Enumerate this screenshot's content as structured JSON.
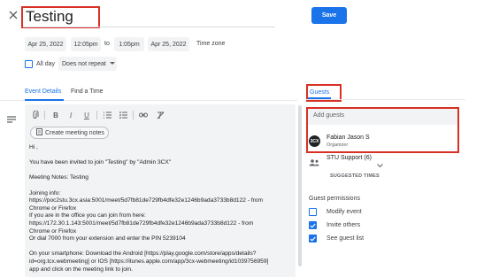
{
  "event": {
    "title": "Testing",
    "save_label": "Save"
  },
  "datetime": {
    "start_date": "Apr 25, 2022",
    "start_time": "12:05pm",
    "to": "to",
    "end_time": "1:05pm",
    "end_date": "Apr 25, 2022",
    "timezone_label": "Time zone",
    "all_day_label": "All day",
    "repeat_value": "Does not repeat"
  },
  "tabs": {
    "event_details": "Event Details",
    "find_a_time": "Find a Time"
  },
  "editor": {
    "meet_button": "Create meeting notes",
    "body": "Hi ,\n\nYou have been invited to join \"Testing\" by \"Admin 3CX\"\n\nMeeting Notes: Testing\n\nJoining info:\nhttps://poc2stu.3cx.asia:5001/meet/5d7fb81de729fb4dfe32e1246b9ada3733b8d122 - from\nChrome or Firefox\nIf you are in the office you can join from here:\nhttps://172.30.1.143:5001/meet/5d7fb81de729fb4dfe32e1246b9ada3733b8d122 - from\nChrome or Firefox\nOr dial 7000 from your extension and enter the PIN 5239104\n\nOn your smartphone: Download the Android [https://play.google.com/store/apps/details?\nid=org.tcx.webmeeting] or IOS [https://itunes.apple.com/app/3cx-webmeeting/id1039756959]\napp and click on the meeting link to join."
  },
  "guests": {
    "tab_label": "Guests",
    "add_placeholder": "Add guests",
    "organizer_name": "Fabian Jason S",
    "organizer_role": "Organizer",
    "avatar_text": "3CX",
    "group_name": "STU Support (6)",
    "suggested_times": "SUGGESTED TIMES",
    "permissions_title": "Guest permissions",
    "permissions": [
      {
        "label": "Modify event",
        "checked": false
      },
      {
        "label": "Invite others",
        "checked": true
      },
      {
        "label": "See guest list",
        "checked": true
      }
    ]
  },
  "colors": {
    "accent": "#1a73e8",
    "highlight": "#d93025"
  }
}
